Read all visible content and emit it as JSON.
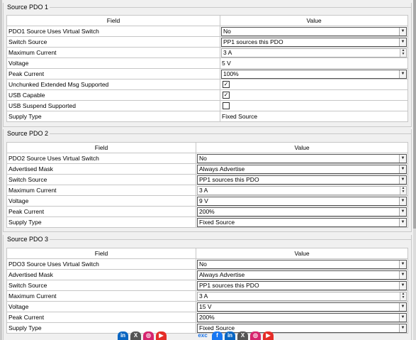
{
  "header": {
    "field": "Field",
    "value": "Value"
  },
  "pdo1": {
    "title": "Source PDO 1",
    "rows": [
      {
        "field": "PDO1 Source Uses Virtual Switch",
        "value": "No"
      },
      {
        "field": "Switch Source",
        "value": "PP1 sources this PDO"
      },
      {
        "field": "Maximum Current",
        "value": "3 A"
      },
      {
        "field": "Voltage",
        "value": "5 V"
      },
      {
        "field": "Peak Current",
        "value": "100%"
      },
      {
        "field": "Unchunked Extended Msg Supported",
        "checked": true
      },
      {
        "field": "USB Capable",
        "checked": true
      },
      {
        "field": "USB Suspend Supported",
        "checked": false
      },
      {
        "field": "Supply Type",
        "value": "Fixed Source"
      }
    ]
  },
  "pdo2": {
    "title": "Source PDO 2",
    "rows": [
      {
        "field": "PDO2 Source Uses Virtual Switch",
        "value": "No"
      },
      {
        "field": "Advertised Mask",
        "value": "Always Advertise"
      },
      {
        "field": "Switch Source",
        "value": "PP1 sources this PDO"
      },
      {
        "field": "Maximum Current",
        "value": "3 A"
      },
      {
        "field": "Voltage",
        "value": "9 V"
      },
      {
        "field": "Peak Current",
        "value": "200%"
      },
      {
        "field": "Supply Type",
        "value": "Fixed Source"
      }
    ]
  },
  "pdo3": {
    "title": "Source PDO 3",
    "rows": [
      {
        "field": "PDO3 Source Uses Virtual Switch",
        "value": "No"
      },
      {
        "field": "Advertised Mask",
        "value": "Always Advertise"
      },
      {
        "field": "Switch Source",
        "value": "PP1 sources this PDO"
      },
      {
        "field": "Maximum Current",
        "value": "3 A"
      },
      {
        "field": "Voltage",
        "value": "15 V"
      },
      {
        "field": "Peak Current",
        "value": "200%"
      },
      {
        "field": "Supply Type",
        "value": "Fixed Source"
      }
    ]
  },
  "check_glyph": "☑",
  "social": {
    "linkedin": "in",
    "x": "X",
    "instagram": "◎",
    "youtube": "▶",
    "facebook": "f",
    "brand": "exc"
  }
}
